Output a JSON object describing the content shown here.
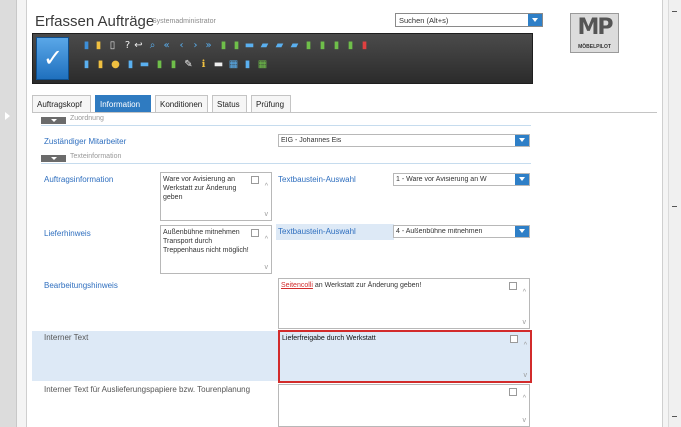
{
  "window": {
    "title": "Erfassen Aufträge",
    "user": "Systemadministrator"
  },
  "search": {
    "placeholder": "Suchen (Alt+s)"
  },
  "logo": {
    "mark": "MP",
    "name": "MÖBELPILOT"
  },
  "tabs": [
    {
      "label": "Auftragskopf"
    },
    {
      "label": "Information"
    },
    {
      "label": "Konditionen"
    },
    {
      "label": "Status"
    },
    {
      "label": "Prüfung"
    }
  ],
  "active_tab": "Information",
  "sections": {
    "zuordnung": "Zuordnung",
    "texte": "Texteinformation"
  },
  "form": {
    "mitarbeiter_label": "Zuständiger Mitarbeiter",
    "mitarbeiter_value": "EIG - Johannes Eis",
    "auftragsinfo_label": "Auftragsinformation",
    "auftragsinfo_text": "Ware vor Avisierung an Werkstatt zur Änderung geben",
    "textbaustein_label_1": "Textbaustein-Auswahl",
    "textbaustein_value_1": "1 - Ware vor Avisierung an W",
    "lieferhinweis_label": "Lieferhinweis",
    "lieferhinweis_text": "Außenbühne mitnehmen Transport durch Treppenhaus nicht möglich!",
    "textbaustein_label_2": "Textbaustein-Auswahl",
    "textbaustein_value_2": "4 - Außenbühne mitnehmen",
    "bearbeitung_label": "Bearbeitungshinweis",
    "bearbeitung_text_underlined": "Seitencolli",
    "bearbeitung_text_rest": " an Werkstatt zur Änderung geben!",
    "intern_label": "Interner Text",
    "intern_text": "Lieferfreigabe durch Werkstatt",
    "auslieferung_label": "Interner Text für Auslieferungspapiere bzw. Tourenplanung",
    "auslieferung_text": ""
  },
  "colors": {
    "accent": "#2f7bc1",
    "highlight": "#dde9f6",
    "focus_border": "#d22b2b",
    "toolbar": "#3a3a3a"
  }
}
